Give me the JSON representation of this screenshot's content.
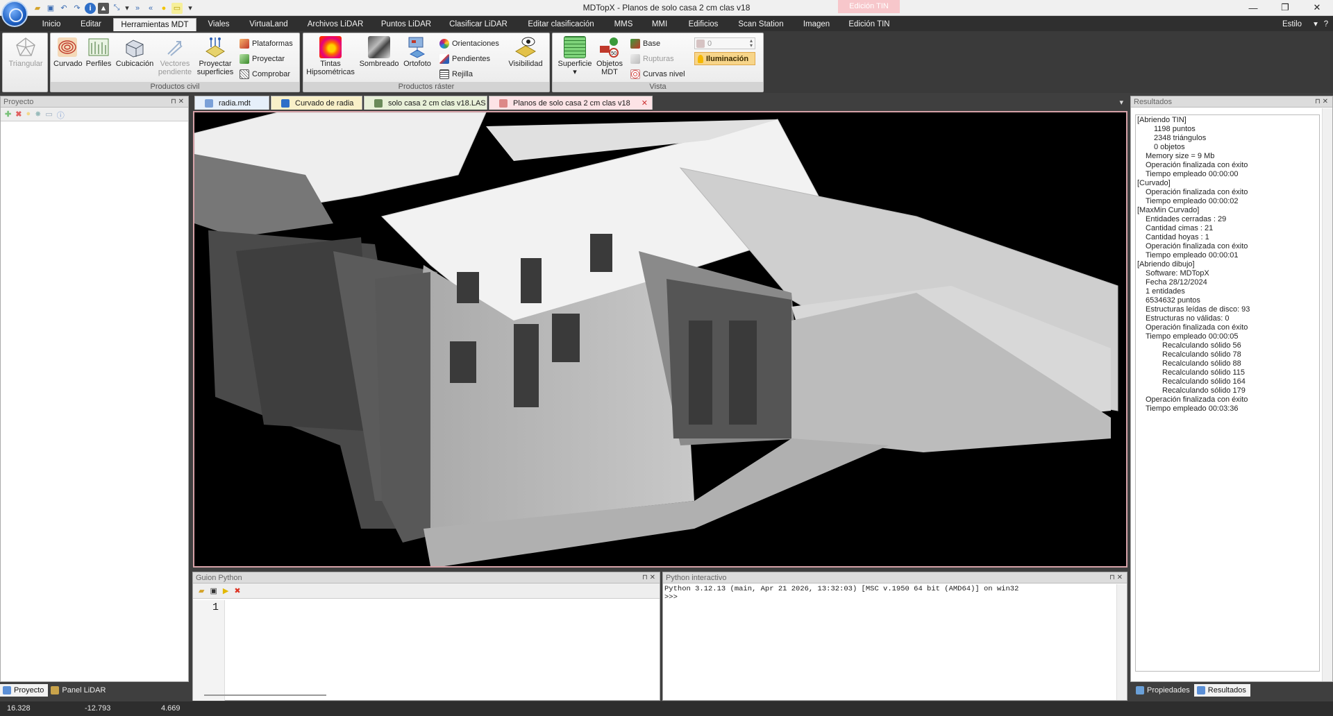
{
  "window": {
    "title": "MDTopX  -  Planos de solo casa 2 cm clas v18",
    "context_tab": "Edición TIN",
    "minimize": "—",
    "maximize": "❐",
    "close": "✕"
  },
  "ribbon_tabs": [
    "Inicio",
    "Editar",
    "Herramientas MDT",
    "Viales",
    "VirtuaLand",
    "Archivos LiDAR",
    "Puntos LiDAR",
    "Clasificar LiDAR",
    "Editar clasificación",
    "MMS",
    "MMI",
    "Edificios",
    "Scan Station",
    "Imagen",
    "Edición TIN"
  ],
  "style_label": "Estilo",
  "ribbon": {
    "triangular": "Triangular",
    "civil": {
      "label": "Productos civil",
      "curvado": "Curvado",
      "perfiles": "Perfiles",
      "cubicacion": "Cubicación",
      "vectores": [
        "Vectores",
        "pendiente"
      ],
      "proyectar_sup": [
        "Proyectar",
        "superficies"
      ],
      "plataformas": "Plataformas",
      "proyectar": "Proyectar",
      "comprobar": "Comprobar"
    },
    "raster": {
      "label": "Productos ráster",
      "tintas": [
        "Tintas",
        "Hipsométricas"
      ],
      "sombreado": "Sombreado",
      "ortofoto": "Ortofoto",
      "orientaciones": "Orientaciones",
      "pendientes": "Pendientes",
      "rejilla": "Rejilla",
      "visibilidad": "Visibilidad"
    },
    "vista": {
      "label": "Vista",
      "superficie": "Superficie",
      "objetos": [
        "Objetos",
        "MDT"
      ],
      "base": "Base",
      "rupturas": "Rupturas",
      "curvas": "Curvas nivel",
      "spin_value": "0",
      "iluminacion": "Iluminación"
    }
  },
  "project_panel": {
    "title": "Proyecto",
    "tabs": [
      "Proyecto",
      "Panel LiDAR"
    ]
  },
  "doc_tabs": [
    "radia.mdt",
    "Curvado de radia",
    "solo casa 2 cm clas v18.LAS",
    "Planos de solo casa 2 cm clas v18"
  ],
  "python_script": {
    "title": "Guion Python",
    "line_number": "1"
  },
  "python_interactive": {
    "title": "Python interactivo",
    "banner": "Python 3.12.13 (main, Apr 21 2026, 13:32:03) [MSC v.1950 64 bit (AMD64)] on win32",
    "prompt": ">>>"
  },
  "results_panel": {
    "title": "Resultados",
    "lines": [
      {
        "indent": 0,
        "text": "[Abriendo TIN]"
      },
      {
        "indent": 2,
        "text": "1198 puntos"
      },
      {
        "indent": 2,
        "text": "2348 triángulos"
      },
      {
        "indent": 2,
        "text": "0 objetos"
      },
      {
        "indent": 1,
        "text": "Memory size = 9 Mb"
      },
      {
        "indent": 1,
        "text": "Operación finalizada con éxito"
      },
      {
        "indent": 1,
        "text": "Tiempo empleado 00:00:00"
      },
      {
        "indent": 0,
        "text": "[Curvado]"
      },
      {
        "indent": 1,
        "text": "Operación finalizada con éxito"
      },
      {
        "indent": 1,
        "text": "Tiempo empleado 00:00:02"
      },
      {
        "indent": 0,
        "text": "[MaxMin Curvado]"
      },
      {
        "indent": 1,
        "text": "Entidades cerradas : 29"
      },
      {
        "indent": 1,
        "text": "Cantidad cimas : 21"
      },
      {
        "indent": 1,
        "text": "Cantidad hoyas : 1"
      },
      {
        "indent": 1,
        "text": "Operación finalizada con éxito"
      },
      {
        "indent": 1,
        "text": "Tiempo empleado 00:00:01"
      },
      {
        "indent": 0,
        "text": "[Abriendo dibujo]"
      },
      {
        "indent": 1,
        "text": "Software: MDTopX"
      },
      {
        "indent": 1,
        "text": "Fecha 28/12/2024"
      },
      {
        "indent": 1,
        "text": "1 entidades"
      },
      {
        "indent": 1,
        "text": "6534632 puntos"
      },
      {
        "indent": 1,
        "text": "Estructuras leídas de disco: 93"
      },
      {
        "indent": 1,
        "text": "Estructuras no válidas: 0"
      },
      {
        "indent": 1,
        "text": "Operación finalizada con éxito"
      },
      {
        "indent": 1,
        "text": "Tiempo empleado 00:00:05"
      },
      {
        "indent": 3,
        "text": "Recalculando sólido 56"
      },
      {
        "indent": 3,
        "text": "Recalculando sólido 78"
      },
      {
        "indent": 3,
        "text": "Recalculando sólido 88"
      },
      {
        "indent": 3,
        "text": "Recalculando sólido 115"
      },
      {
        "indent": 3,
        "text": "Recalculando sólido 164"
      },
      {
        "indent": 3,
        "text": "Recalculando sólido 179"
      },
      {
        "indent": 1,
        "text": "Operación finalizada con éxito"
      },
      {
        "indent": 1,
        "text": "Tiempo empleado 00:03:36"
      }
    ],
    "tabs": [
      "Propiedades",
      "Resultados"
    ]
  },
  "status": {
    "x": "16.328",
    "y": "-12.793",
    "z": "4.669"
  },
  "colors": {
    "accent": "#d6a2a8",
    "context": "#f7c7cb",
    "highlight": "#f7d58a"
  }
}
